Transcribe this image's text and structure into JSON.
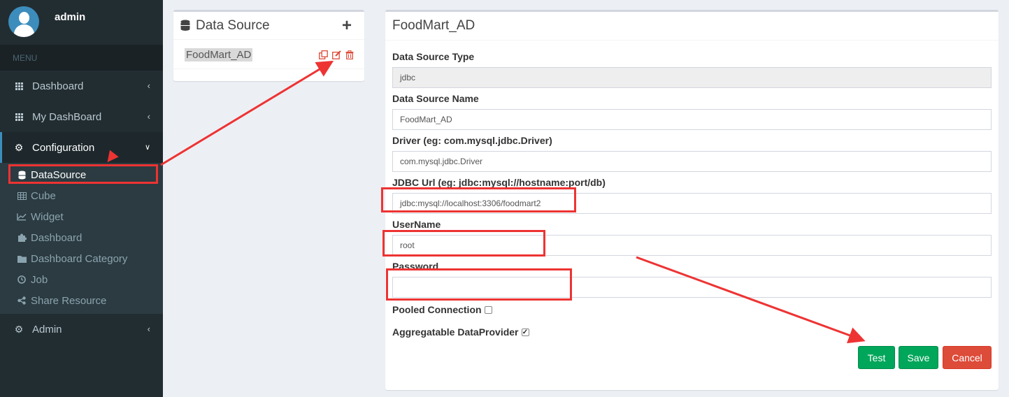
{
  "user": {
    "name": "admin"
  },
  "sidebar": {
    "header": "MENU",
    "items": [
      {
        "label": "Dashboard",
        "icon": "th-icon"
      },
      {
        "label": "My DashBoard",
        "icon": "th-icon"
      },
      {
        "label": "Configuration",
        "icon": "gear-icon"
      }
    ],
    "sub_items": [
      {
        "label": "DataSource",
        "icon": "database-icon"
      },
      {
        "label": "Cube",
        "icon": "table-icon"
      },
      {
        "label": "Widget",
        "icon": "line-chart-icon"
      },
      {
        "label": "Dashboard",
        "icon": "puzzle-icon"
      },
      {
        "label": "Dashboard Category",
        "icon": "folder-icon"
      },
      {
        "label": "Job",
        "icon": "clock-icon"
      },
      {
        "label": "Share Resource",
        "icon": "share-icon"
      }
    ],
    "admin": {
      "label": "Admin",
      "icon": "gear-icon"
    }
  },
  "datasource_panel": {
    "title": "Data Source",
    "items": [
      {
        "name": "FoodMart_AD"
      }
    ]
  },
  "form": {
    "title": "FoodMart_AD",
    "type_label": "Data Source Type",
    "type_value": "jdbc",
    "name_label": "Data Source Name",
    "name_value": "FoodMart_AD",
    "driver_label": "Driver (eg: com.mysql.jdbc.Driver)",
    "driver_value": "com.mysql.jdbc.Driver",
    "url_label": "JDBC Url (eg: jdbc:mysql://hostname:port/db)",
    "url_value": "jdbc:mysql://localhost:3306/foodmart2",
    "user_label": "UserName",
    "user_value": "root",
    "password_label": "Password",
    "password_value": "",
    "pooled_label": "Pooled Connection",
    "pooled_checked": false,
    "aggregatable_label": "Aggregatable DataProvider",
    "aggregatable_checked": true,
    "test_label": "Test",
    "save_label": "Save",
    "cancel_label": "Cancel"
  },
  "colors": {
    "sidebar_bg": "#222d32",
    "accent": "#3c8dbc",
    "success": "#00a65a",
    "danger": "#dd4b39",
    "annotation": "#ee3333"
  }
}
